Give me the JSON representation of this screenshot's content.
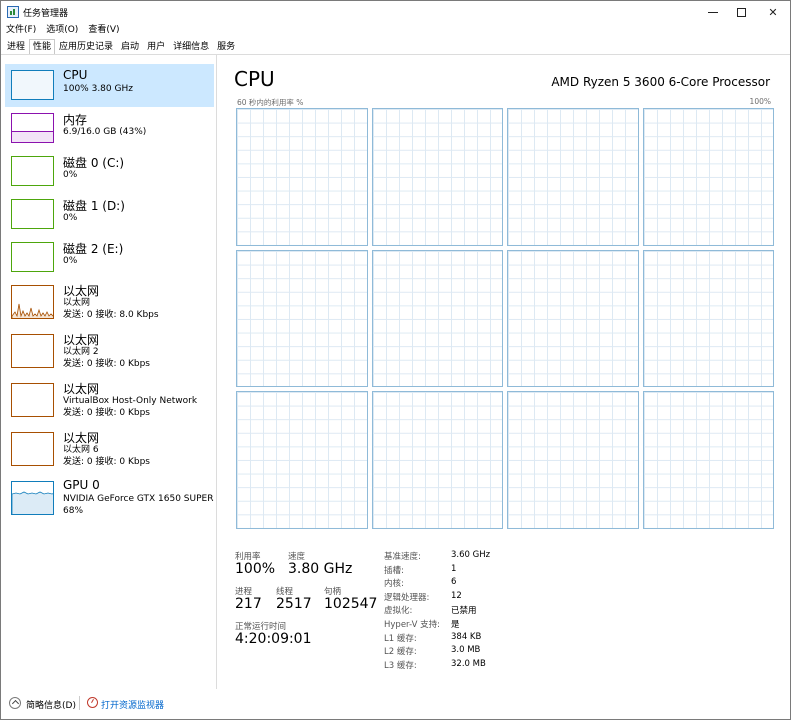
{
  "window": {
    "title": "任务管理器",
    "controls": [
      "minimize-icon",
      "maximize-icon",
      "close-icon"
    ]
  },
  "menu": [
    "文件(F)",
    "选项(O)",
    "查看(V)"
  ],
  "tabs": [
    {
      "label": "进程",
      "active": false
    },
    {
      "label": "性能",
      "active": true
    },
    {
      "label": "应用历史记录",
      "active": false
    },
    {
      "label": "启动",
      "active": false
    },
    {
      "label": "用户",
      "active": false
    },
    {
      "label": "详细信息",
      "active": false
    },
    {
      "label": "服务",
      "active": false
    }
  ],
  "sidebar": [
    {
      "title": "CPU",
      "sub": "100%  3.80 GHz",
      "color": "#117dbb",
      "selected": true
    },
    {
      "title": "内存",
      "sub": "6.9/16.0 GB (43%)",
      "color": "#8b12ae"
    },
    {
      "title": "磁盘 0 (C:)",
      "sub": "0%",
      "color": "#4da60c"
    },
    {
      "title": "磁盘 1 (D:)",
      "sub": "0%",
      "color": "#4da60c"
    },
    {
      "title": "磁盘 2 (E:)",
      "sub": "0%",
      "color": "#4da60c"
    },
    {
      "title": "以太网",
      "sub1": "以太网",
      "sub2": "发送: 0 接收: 8.0 Kbps",
      "color": "#a74f01"
    },
    {
      "title": "以太网",
      "sub1": "以太网 2",
      "sub2": "发送: 0 接收: 0 Kbps",
      "color": "#a74f01"
    },
    {
      "title": "以太网",
      "sub1": "VirtualBox Host-Only Network",
      "sub2": "发送: 0 接收: 0 Kbps",
      "color": "#a74f01"
    },
    {
      "title": "以太网",
      "sub1": "以太网 6",
      "sub2": "发送: 0 接收: 0 Kbps",
      "color": "#a74f01"
    },
    {
      "title": "GPU 0",
      "sub1": "NVIDIA GeForce GTX 1650 SUPER",
      "sub2": "68%",
      "color": "#117dbb"
    }
  ],
  "main": {
    "title": "CPU",
    "processor": "AMD Ryzen 5 3600 6-Core Processor",
    "axis_left": "60 秒内的利用率 %",
    "axis_right": "100%",
    "logical_graph_count": 12
  },
  "stats": {
    "util_label": "利用率",
    "util_value": "100%",
    "speed_label": "速度",
    "speed_value": "3.80 GHz",
    "proc_label": "进程",
    "proc_value": "217",
    "thread_label": "线程",
    "thread_value": "2517",
    "handle_label": "句柄",
    "handle_value": "102547",
    "uptime_label": "正常运行时间",
    "uptime_value": "4:20:09:01"
  },
  "specs": [
    {
      "k": "基准速度:",
      "v": "3.60 GHz"
    },
    {
      "k": "插槽:",
      "v": "1"
    },
    {
      "k": "内核:",
      "v": "6"
    },
    {
      "k": "逻辑处理器:",
      "v": "12"
    },
    {
      "k": "虚拟化:",
      "v": "已禁用"
    },
    {
      "k": "Hyper-V 支持:",
      "v": "是"
    },
    {
      "k": "L1 缓存:",
      "v": "384 KB"
    },
    {
      "k": "L2 缓存:",
      "v": "3.0 MB"
    },
    {
      "k": "L3 缓存:",
      "v": "32.0 MB"
    }
  ],
  "footer": {
    "brief": "简略信息(D)",
    "resmon": "打开资源监视器"
  }
}
